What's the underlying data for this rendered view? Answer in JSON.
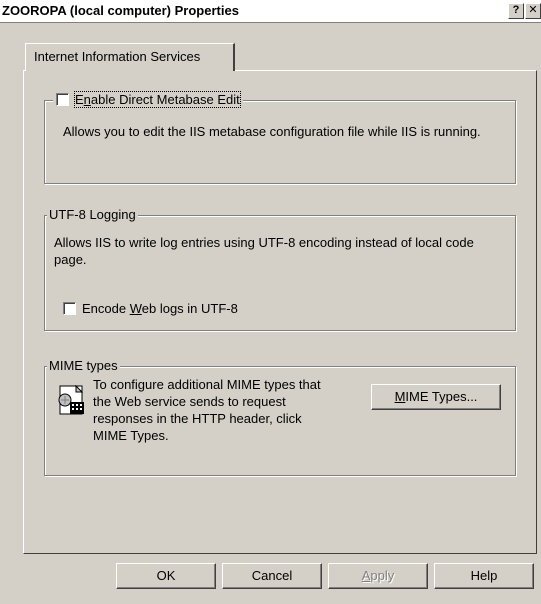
{
  "window": {
    "title": "ZOOROPA (local computer) Properties",
    "help_glyph": "?",
    "close_glyph": "✕"
  },
  "tabs": [
    {
      "label": "Internet Information Services",
      "selected": true
    }
  ],
  "metabase": {
    "checkbox_label_prefix": "E",
    "checkbox_label_accel": "n",
    "checkbox_label_rest": "able Direct Metabase Edit",
    "checked": false,
    "description": "Allows you to edit the IIS metabase configuration file while IIS is running."
  },
  "utf8": {
    "legend": "UTF-8 Logging",
    "description": "Allows IIS to write log entries using UTF-8 encoding instead of local code page.",
    "checkbox_label_prefix": "Encode ",
    "checkbox_label_accel": "W",
    "checkbox_label_rest": "eb logs in UTF-8",
    "checked": false
  },
  "mime": {
    "legend": "MIME types",
    "description": "To configure additional MIME types that the Web service sends to request responses in the HTTP header, click MIME Types.",
    "button_accel": "M",
    "button_rest": "IME Types...",
    "icon": "mime-types-icon"
  },
  "buttons": {
    "ok": "OK",
    "cancel": "Cancel",
    "apply_accel": "A",
    "apply_rest": "pply",
    "help": "Help"
  }
}
